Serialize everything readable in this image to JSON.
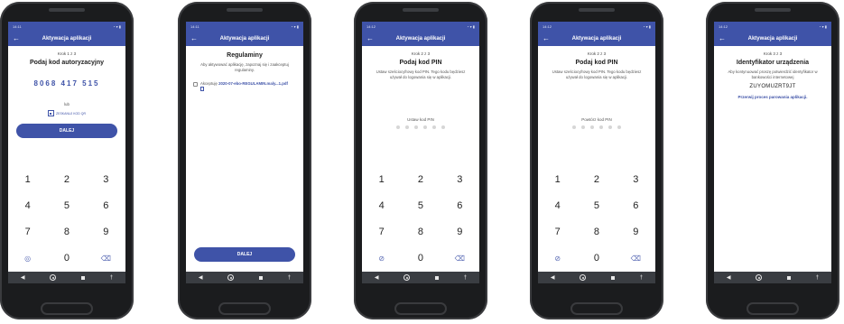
{
  "common": {
    "time": "14:11",
    "time_alt": "14:12",
    "status_icons": "◔ ▾ ▮",
    "app_title": "Aktywacja aplikacji",
    "back_glyph": "←",
    "nav": {
      "back": "◀",
      "extra": "†"
    },
    "keypad": [
      "1",
      "2",
      "3",
      "4",
      "5",
      "6",
      "7",
      "8",
      "9",
      "",
      "0",
      "⌫"
    ],
    "eye_glyph": "◎",
    "eye_off_glyph": "⊘"
  },
  "screen1": {
    "step": "Krok 1 z 3",
    "heading": "Podaj kod autoryzacyjny",
    "code": "8068 417 515",
    "or": "lub",
    "qr_label": "ZESKANUJ KOD QR",
    "button": "DALEJ"
  },
  "screen2": {
    "heading": "Regulaminy",
    "desc": "Aby aktywować aplikację, zapoznaj się i zaakceptuj regulaminy.",
    "accept_prefix": "Akceptuję",
    "file": "2020-07-ebo-REGULAMIN.maly...1.pdf",
    "button": "DALEJ"
  },
  "screen3": {
    "step": "Krok 2 z 3",
    "heading": "Podaj kod PIN",
    "desc": "Ustaw sześciocyfrowy kod PIN. Tego kodu będziesz używał do logowania się w aplikacji.",
    "pin_label": "Ustaw kod PIN"
  },
  "screen4": {
    "step": "Krok 2 z 3",
    "heading": "Podaj kod PIN",
    "desc": "Ustaw sześciocyfrowy kod PIN. Tego kodu będziesz używał do logowania się w aplikacji.",
    "pin_label": "Powtórz kod PIN"
  },
  "screen5": {
    "step": "Krok 3 z 3",
    "heading": "Identyfikator urządzenia",
    "desc": "Aby kontynuować proszę potwierdzić identyfikator w bankowości internetowej",
    "device_id": "ZUYOMUZRT9JT",
    "link": "Przerwij proces parowania aplikacji."
  },
  "colors": {
    "accent": "#3f53a8",
    "phone_body": "#1b1c1e",
    "nav_bar": "#3a3d42"
  }
}
